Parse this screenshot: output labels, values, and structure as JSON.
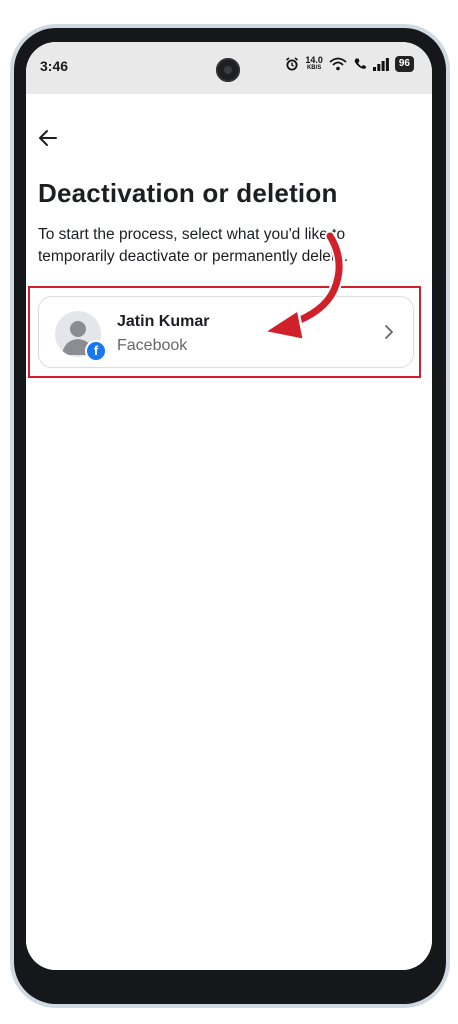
{
  "status_bar": {
    "time": "3:46",
    "net_speed": "14.0",
    "net_unit": "KB/S",
    "battery": "96"
  },
  "header": {
    "back_icon": "arrow-left-icon"
  },
  "page": {
    "title": "Deactivation or deletion",
    "description": "To start the process, select what you'd like to temporarily deactivate or permanently delete."
  },
  "account": {
    "name": "Jatin Kumar",
    "platform": "Facebook",
    "badge_icon": "facebook-icon",
    "chevron_icon": "chevron-right-icon"
  },
  "colors": {
    "highlight": "#d0212b",
    "facebook_blue": "#1877f2",
    "text_primary": "#1c1e21",
    "text_secondary": "#65676b"
  }
}
